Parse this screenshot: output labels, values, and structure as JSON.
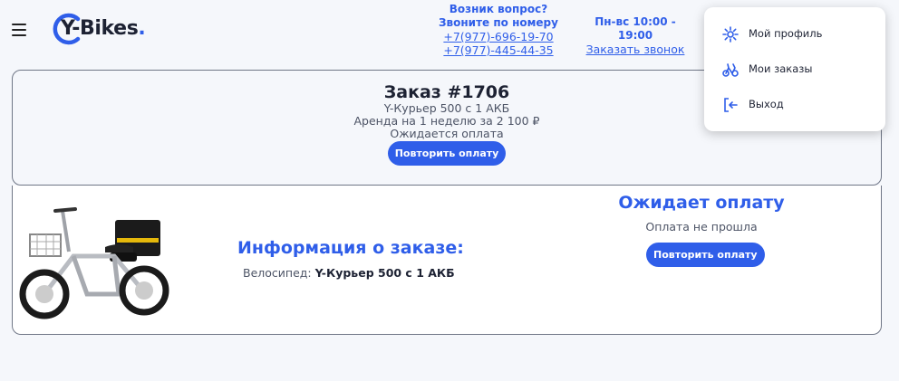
{
  "header": {
    "logo_text": "Y-Bikes",
    "logo_dot": ".",
    "contact_question_1": "Возник вопрос?",
    "contact_question_2": "Звоните по номеру",
    "phone_1": "+7(977)-696-19-70",
    "phone_2": "+7(977)-445-44-35",
    "hours": "Пн-вс 10:00 - 19:00",
    "callback_label": "Заказать звонок"
  },
  "user_menu": {
    "items": [
      {
        "label": "Мой профиль",
        "icon": "gear-icon"
      },
      {
        "label": "Мои заказы",
        "icon": "bike-icon"
      },
      {
        "label": "Выход",
        "icon": "logout-icon"
      }
    ]
  },
  "order": {
    "title": "Заказ #1706",
    "bike": "Y-Курьер 500 с 1 АКБ",
    "rent": "Аренда на 1 неделю за 2 100 ₽",
    "state": "Ожидается оплата",
    "retry_label": "Повторить оплату"
  },
  "details": {
    "info_title": "Информация о заказе:",
    "bike_label": "Велосипед: ",
    "bike_value": "Y-Курьер 500 с 1 АКБ",
    "status_title": "Ожидает оплату",
    "status_sub": "Оплата не прошла",
    "retry_label": "Повторить оплату"
  },
  "colors": {
    "accent": "#2f5ee9",
    "background": "#f5f7fb",
    "text": "#1d2233",
    "muted": "#4d5466"
  }
}
